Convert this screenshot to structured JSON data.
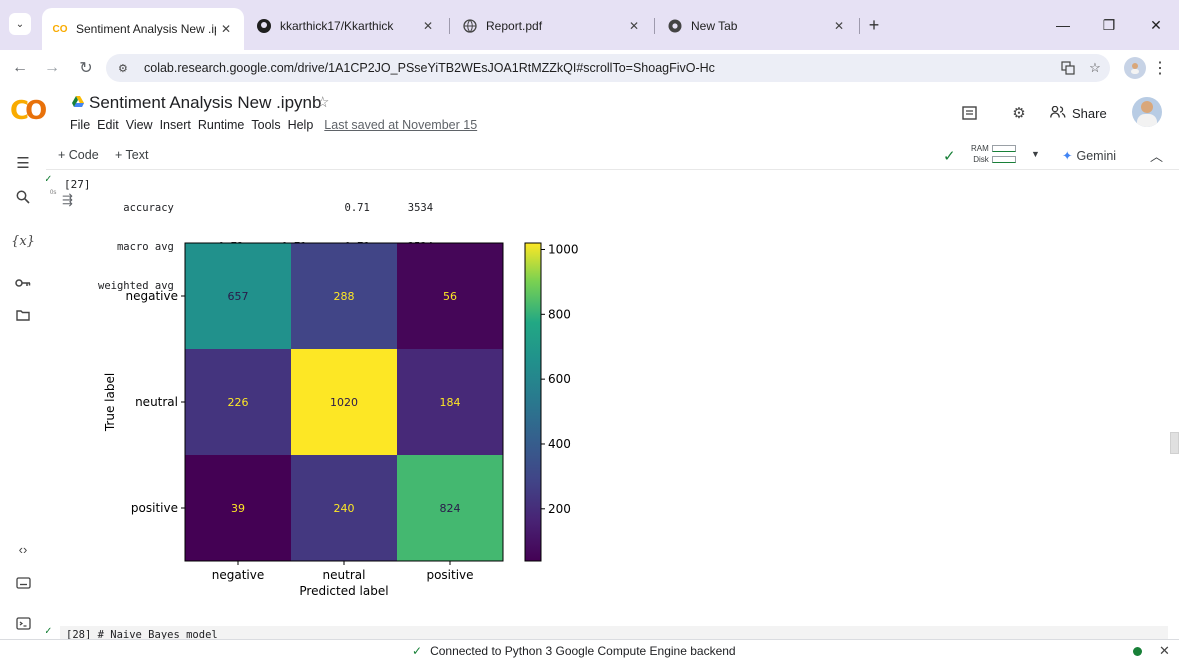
{
  "browser": {
    "tabs": [
      {
        "title": "Sentiment Analysis New .ipynb",
        "close": "✕",
        "active": true
      },
      {
        "title": "kkarthick17/Kkarthick",
        "close": "✕",
        "active": false
      },
      {
        "title": "Report.pdf",
        "close": "✕",
        "active": false
      },
      {
        "title": "New Tab",
        "close": "✕",
        "active": false
      }
    ],
    "new_tab": "+",
    "url": "colab.research.google.com/drive/1A1CP2JO_PSseYiTB2WEsJOA1RtMZZkQI#scrollTo=ShoagFivO-Hc",
    "window_controls": {
      "minimize": "—",
      "restore": "❐",
      "close": "✕"
    }
  },
  "colab": {
    "notebook_title": "Sentiment Analysis New .ipynb",
    "menu": [
      "File",
      "Edit",
      "View",
      "Insert",
      "Runtime",
      "Tools",
      "Help"
    ],
    "last_saved": "Last saved at November 15",
    "share_label": "Share",
    "add_code": "+ Code",
    "add_text": "+ Text",
    "ram_label": "RAM",
    "disk_label": "Disk",
    "gemini_label": "Gemini"
  },
  "cell": {
    "execution_count": "[27]",
    "run_time": "0s",
    "report_lines": [
      "    accuracy                           0.71      3534",
      "   macro avg       0.72      0.71      0.71      3534",
      "weighted avg       0.71      0.71      0.71      3534"
    ],
    "next_cell_code": "[28] # Naive Bayes model"
  },
  "chart_data": {
    "type": "heatmap",
    "title": "",
    "xlabel": "Predicted label",
    "ylabel": "True label",
    "x_categories": [
      "negative",
      "neutral",
      "positive"
    ],
    "y_categories": [
      "negative",
      "neutral",
      "positive"
    ],
    "values": [
      [
        657,
        288,
        56
      ],
      [
        226,
        1020,
        184
      ],
      [
        39,
        240,
        824
      ]
    ],
    "colormap": "viridis",
    "colorbar_ticks": [
      "200",
      "400",
      "600",
      "800",
      "1000"
    ],
    "colorbar_tick_values": [
      200,
      400,
      600,
      800,
      1000
    ],
    "vmin": 39,
    "vmax": 1020
  },
  "status": {
    "message": "Connected to Python 3 Google Compute Engine backend"
  },
  "colors": {
    "accent_green": "#188038",
    "tabstrip": "#e6e1f4"
  }
}
